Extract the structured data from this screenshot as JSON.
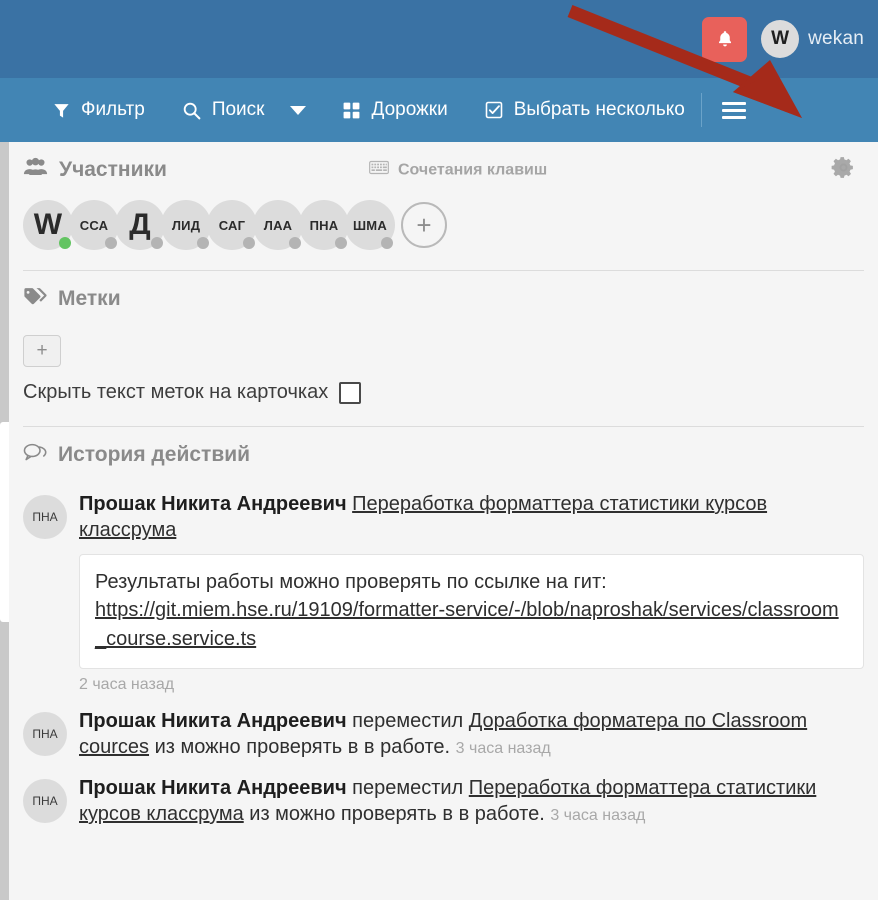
{
  "colors": {
    "header_blue": "#3a72a4",
    "toolbar_blue": "#4285b4",
    "notification_red": "#e8615b",
    "arrow_red": "#a52a1a",
    "sidebar_bg": "#f5f5f5",
    "online_dot": "#63c462"
  },
  "header": {
    "notification_icon": "bell-icon",
    "avatar_initial": "W",
    "username": "wekan"
  },
  "toolbar": {
    "items": [
      {
        "icon": "filter-icon",
        "label": "Фильтр"
      },
      {
        "icon": "search-icon",
        "label": "Поиск"
      },
      {
        "icon": "chevron-down-icon",
        "label": ""
      },
      {
        "icon": "swimlanes-grid-icon",
        "label": "Дорожки"
      },
      {
        "icon": "checkbox-icon",
        "label": "Выбрать несколько"
      }
    ],
    "menu_icon": "hamburger-menu-icon"
  },
  "sidebar": {
    "members_section": {
      "icon": "members-icon",
      "title": "Участники",
      "shortcuts_icon": "keyboard-icon",
      "shortcuts_label": "Сочетания клавиш",
      "settings_icon": "gear-icon",
      "members": [
        {
          "initials": "W",
          "big": true,
          "online": true
        },
        {
          "initials": "ССА",
          "big": false,
          "online": false
        },
        {
          "initials": "Д",
          "big": true,
          "online": false
        },
        {
          "initials": "ЛИД",
          "big": false,
          "online": false
        },
        {
          "initials": "САГ",
          "big": false,
          "online": false
        },
        {
          "initials": "ЛАА",
          "big": false,
          "online": false
        },
        {
          "initials": "ПНА",
          "big": false,
          "online": false
        },
        {
          "initials": "ШМА",
          "big": false,
          "online": false
        }
      ],
      "add_member_label": "+"
    },
    "labels_section": {
      "icon": "tag-icon",
      "title": "Метки",
      "add_label": "+",
      "hide_label_text": "Скрыть текст меток на карточках",
      "hide_label_checked": false
    },
    "activity_section": {
      "icon": "comment-icon",
      "title": "История действий",
      "entries": [
        {
          "avatar": "ПНА",
          "author": "Прошак Никита Андреевич",
          "action": "",
          "link": "Переработка форматтера статистики курсов классрума",
          "tail": "",
          "comment_text": "Результаты работы можно проверять по ссылке на гит:",
          "comment_url": "https://git.miem.hse.ru/19109/formatter-service/-/blob/naproshak/services/classroom_course.service.ts",
          "time": "2 часа назад"
        },
        {
          "avatar": "ПНА",
          "author": "Прошак Никита Андреевич",
          "action": " переместил ",
          "link": "Доработка форматера по Classroom cources",
          "tail": " из можно проверять в в работе.",
          "comment_text": "",
          "comment_url": "",
          "time": "3 часа назад"
        },
        {
          "avatar": "ПНА",
          "author": "Прошак Никита Андреевич",
          "action": " переместил ",
          "link": "Переработка форматтера статистики курсов классрума",
          "tail": " из можно проверять в в работе.",
          "comment_text": "",
          "comment_url": "",
          "time": "3 часа назад"
        }
      ]
    }
  },
  "annotation": {
    "arrow_icon": "red-pointer-arrow",
    "points_to": "hamburger-menu-icon"
  }
}
